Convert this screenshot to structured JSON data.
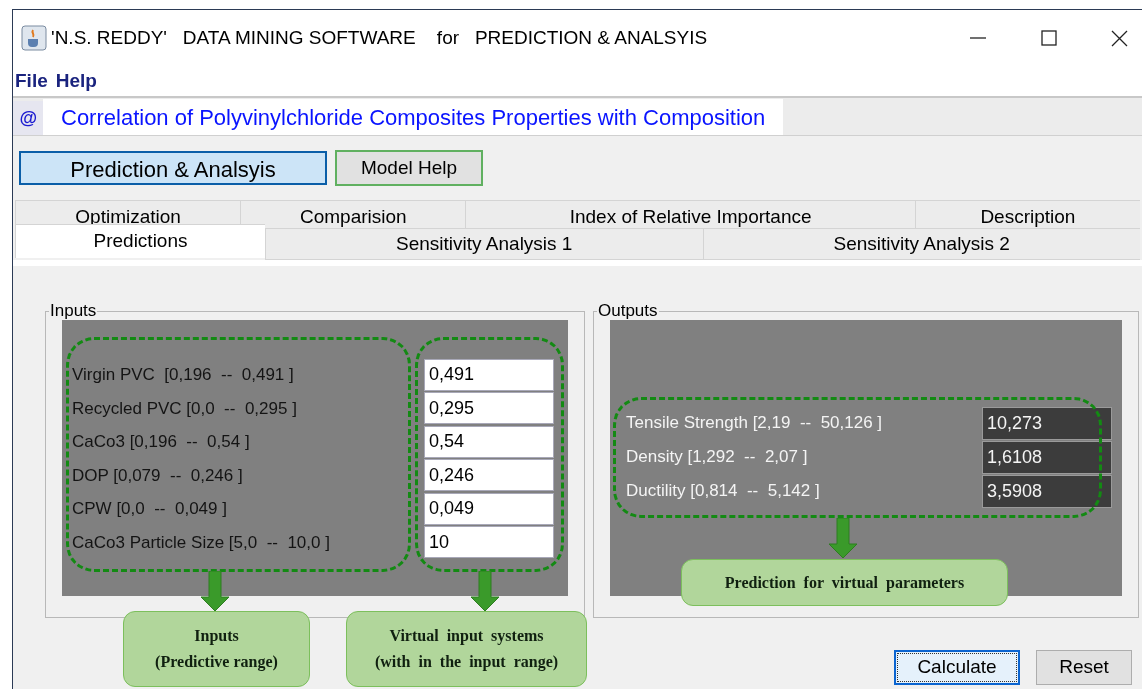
{
  "window": {
    "title": "'N.S. REDDY'   DATA MINING SOFTWARE    for   PREDICTION & ANALSYIS"
  },
  "menu": [
    {
      "label": "File"
    },
    {
      "label": "Help"
    }
  ],
  "header_tab": {
    "icon_text": "@",
    "label": "Correlation of Polyvinylchloride Composites Properties with Composition"
  },
  "mode_buttons": [
    {
      "label": "Prediction & Analsyis",
      "selected": true
    },
    {
      "label": "Model Help",
      "selected": false
    }
  ],
  "tabs_back_row": [
    {
      "label": "Optimization",
      "selected": false
    },
    {
      "label": "Comparision",
      "selected": false
    },
    {
      "label": "Index of Relative Importance",
      "selected": false
    },
    {
      "label": "Description",
      "selected": false
    }
  ],
  "tabs_front_row": [
    {
      "label": "Predictions",
      "selected": true
    },
    {
      "label": "Sensitivity Analysis 1",
      "selected": false
    },
    {
      "label": "Sensitivity Analysis 2",
      "selected": false
    }
  ],
  "inputs": {
    "title": "Inputs",
    "rows": [
      {
        "label": "Virgin PVC  [0,196  --  0,491 ]",
        "value": "0,491"
      },
      {
        "label": "Recycled PVC [0,0  --  0,295 ]",
        "value": "0,295"
      },
      {
        "label": "CaCo3 [0,196  --  0,54 ]",
        "value": "0,54"
      },
      {
        "label": "DOP [0,079  --  0,246 ]",
        "value": "0,246"
      },
      {
        "label": "CPW [0,0  --  0,049 ]",
        "value": "0,049"
      },
      {
        "label": "CaCo3 Particle Size [5,0  --  10,0 ]",
        "value": "10"
      }
    ]
  },
  "outputs": {
    "title": "Outputs",
    "rows": [
      {
        "label": "Tensile Strength [2,19  --  50,126 ]",
        "value": "10,273"
      },
      {
        "label": "Density [1,292  --  2,07 ]",
        "value": "1,6108"
      },
      {
        "label": "Ductility [0,814  --  5,142 ]",
        "value": "3,5908"
      }
    ]
  },
  "annotations": [
    {
      "lines": [
        "Inputs",
        "(Predictive range)"
      ]
    },
    {
      "lines": [
        "Virtual  input  systems",
        "(with  in  the  input  range)"
      ]
    },
    {
      "lines": [
        "Prediction  for  virtual  parameters"
      ]
    }
  ],
  "buttons": [
    {
      "label": "Calculate",
      "focused": true
    },
    {
      "label": "Reset",
      "focused": false
    }
  ]
}
